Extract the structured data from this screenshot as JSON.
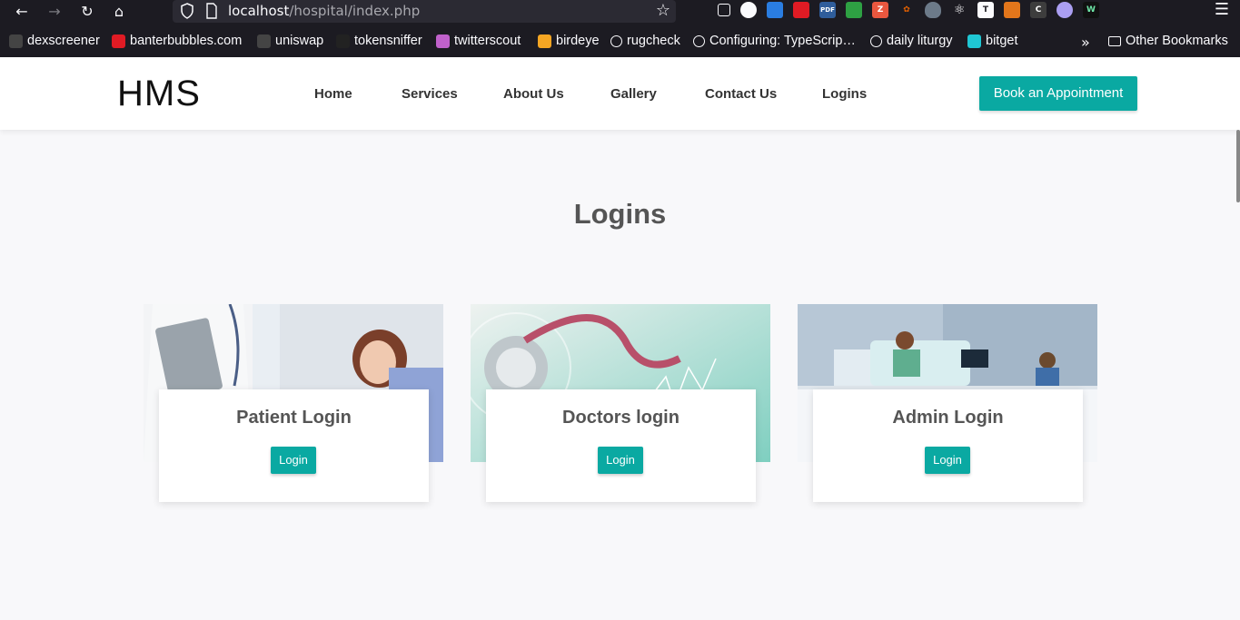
{
  "browser": {
    "url_host": "localhost",
    "url_path": "/hospital/index.php",
    "bookmarks": [
      {
        "label": "dexscreener",
        "icon": "dexscreener-icon",
        "color": "#444444"
      },
      {
        "label": "banterbubbles.com",
        "icon": "banterbubbles-icon",
        "color": "#e01b24"
      },
      {
        "label": "uniswap",
        "icon": "uniswap-icon",
        "color": "#444444"
      },
      {
        "label": "tokensniffer",
        "icon": "tokensniffer-icon",
        "color": "#222222"
      },
      {
        "label": "twitterscout",
        "icon": "twitterscout-icon",
        "color": "#c061cb"
      },
      {
        "label": "birdeye",
        "icon": "birdeye-icon",
        "color": "#f5a623"
      },
      {
        "label": "rugcheck",
        "icon": "globe-icon",
        "color": "#1c1b22"
      },
      {
        "label": "Configuring: TypeScrip…",
        "icon": "globe-icon",
        "color": "#1c1b22"
      },
      {
        "label": "daily liturgy",
        "icon": "cross-icon",
        "color": "#1c1b22"
      },
      {
        "label": "bitget",
        "icon": "bitget-icon",
        "color": "#1fc7d4"
      }
    ],
    "other_bookmarks": "Other Bookmarks"
  },
  "site": {
    "logo": "HMS",
    "nav": [
      "Home",
      "Services",
      "About Us",
      "Gallery",
      "Contact Us",
      "Logins"
    ],
    "cta": "Book an Appointment"
  },
  "section": {
    "title": "Logins",
    "cards": [
      {
        "title": "Patient Login",
        "button": "Login"
      },
      {
        "title": "Doctors login",
        "button": "Login"
      },
      {
        "title": "Admin Login",
        "button": "Login"
      }
    ]
  },
  "colors": {
    "accent": "#0aa9a2",
    "chrome_bg": "#1c1b22",
    "page_bg": "#f8f8fa"
  }
}
